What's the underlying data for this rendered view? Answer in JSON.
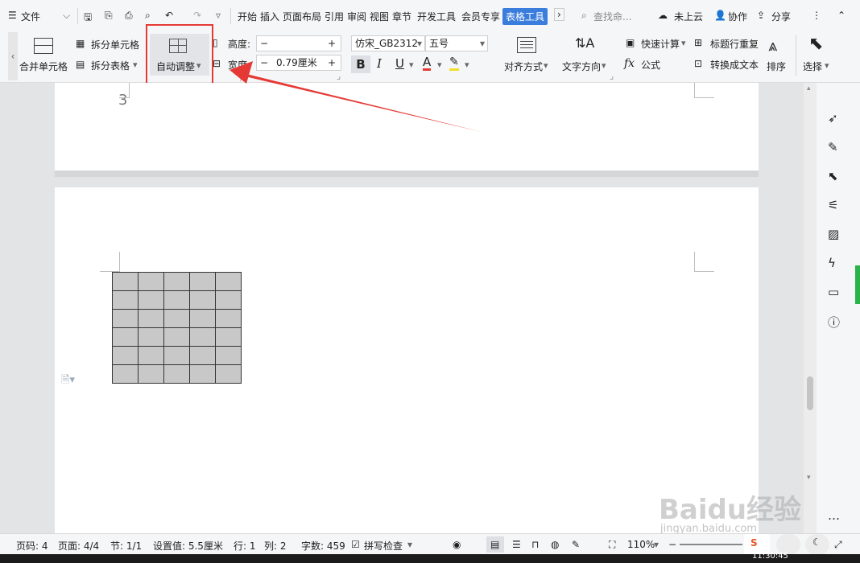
{
  "titlebar": {
    "file_menu": "文件",
    "tabs": [
      "开始",
      "插入",
      "页面布局",
      "引用",
      "审阅",
      "视图",
      "章节",
      "开发工具",
      "会员专享"
    ],
    "active_tab": "表格工具",
    "search_placeholder": "查找命...",
    "cloud_label": "未上云",
    "collab_label": "协作",
    "share_label": "分享"
  },
  "ribbon": {
    "merge_cells": "合并单元格",
    "split_cells": "拆分单元格",
    "split_table": "拆分表格",
    "auto_fit": "自动调整",
    "height_label": "高度:",
    "width_label": "宽度:",
    "height_value": "",
    "width_value": "0.79厘米",
    "font_name": "仿宋_GB2312",
    "font_size": "五号",
    "bold": "B",
    "italic": "I",
    "underline": "U",
    "font_color": "A",
    "align": "对齐方式",
    "text_direction": "文字方向",
    "quick_calc": "快速计算",
    "formula": "公式",
    "header_repeat": "标题行重复",
    "convert_text": "转换成文本",
    "sort": "排序",
    "select": "选择"
  },
  "document": {
    "page_number_text": "3"
  },
  "statusbar": {
    "page_code": "页码: 4",
    "page": "页面: 4/4",
    "section": "节: 1/1",
    "setting": "设置值: 5.5厘米",
    "row": "行: 1",
    "col": "列: 2",
    "word_count": "字数: 459",
    "spell_check": "拼写检查",
    "zoom": "110%",
    "clock": "11:30:45"
  },
  "watermark": {
    "brand": "Baidu经验",
    "url": "jingyan.baidu.com"
  },
  "colors": {
    "accent": "#3b7ddd",
    "highlight_box": "#e53935",
    "arrow": "#e53935",
    "table_fill": "#c8c8c8"
  }
}
